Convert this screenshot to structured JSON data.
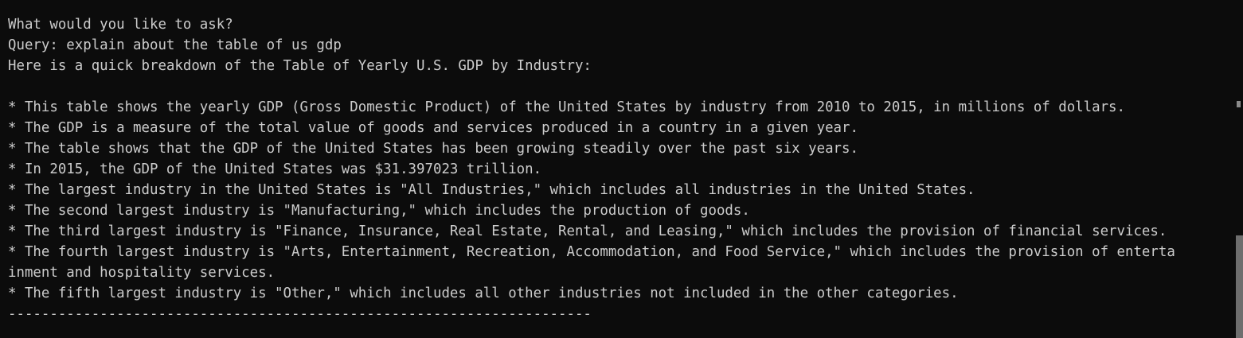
{
  "terminal": {
    "prompt_question": "What would you like to ask?",
    "query_line": "Query: explain about the table of us gdp",
    "response_intro": "Here is a quick breakdown of the Table of Yearly U.S. GDP by Industry:",
    "bullets": [
      "* This table shows the yearly GDP (Gross Domestic Product) of the United States by industry from 2010 to 2015, in millions of dollars.",
      "* The GDP is a measure of the total value of goods and services produced in a country in a given year.",
      "* The table shows that the GDP of the United States has been growing steadily over the past six years.",
      "* In 2015, the GDP of the United States was $31.397023 trillion.",
      "* The largest industry in the United States is \"All Industries,\" which includes all industries in the United States.",
      "* The second largest industry is \"Manufacturing,\" which includes the production of goods.",
      "* The third largest industry is \"Finance, Insurance, Real Estate, Rental, and Leasing,\" which includes the provision of financial services.",
      "* The fourth largest industry is \"Arts, Entertainment, Recreation, Accommodation, and Food Service,\" which includes the provision of enterta",
      "inment and hospitality services.",
      "* The fifth largest industry is \"Other,\" which includes all other industries not included in the other categories."
    ],
    "separator": "----------------------------------------------------------------------",
    "colors": {
      "background": "#0c0c0c",
      "foreground": "#cccccc",
      "scrollbar_thumb": "#6e6e6e"
    }
  }
}
